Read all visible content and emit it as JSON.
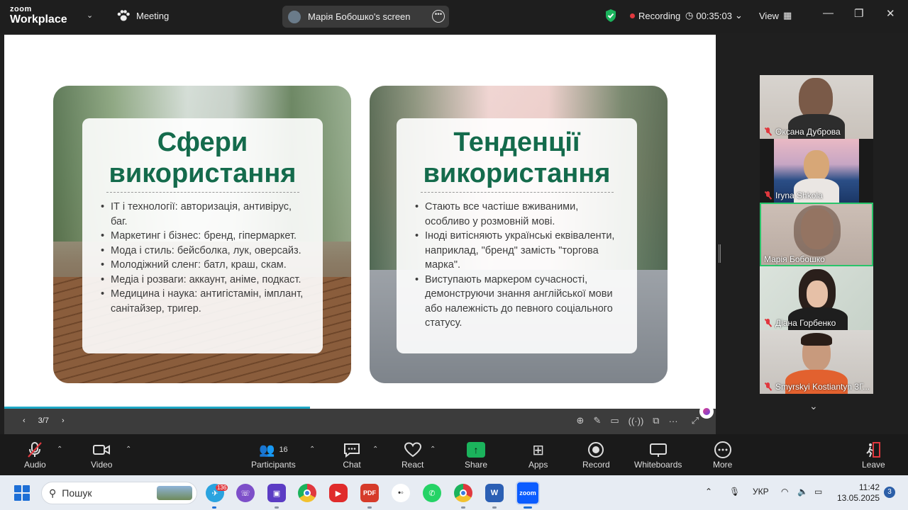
{
  "app": {
    "logo_line1": "zoom",
    "logo_line2": "Workplace",
    "meeting_label": "Meeting"
  },
  "header": {
    "screen_share_label": "Марія Бобошко's screen",
    "recording_label": "Recording",
    "timer": "00:35:03",
    "view_label": "View"
  },
  "slide": {
    "left": {
      "title_line1": "Сфери",
      "title_line2": "використання",
      "bullets": [
        "ІТ і технології: авторизація, антивірус, баг.",
        "Маркетинг і бізнес: бренд, гіпермаркет.",
        "Мода і стиль: бейсболка, лук, оверсайз.",
        "Молодіжний сленг: батл, краш, скам.",
        "Медіа і розваги: аккаунт, аніме, подкаст.",
        "Медицина і наука: антигістамін, імплант, санітайзер, тригер."
      ]
    },
    "right": {
      "title_line1": "Тенденції",
      "title_line2": "використання",
      "bullets": [
        "Стають все частіше вживаними, особливо у розмовній мові.",
        "Іноді витісняють українські еквіваленти, наприклад, \"бренд\" замість \"торгова марка\".",
        "Виступають маркером сучасності, демонструючи знання англійської мови або належність до певного соціального статусу."
      ]
    },
    "page_indicator": "3/7",
    "progress_fraction": 0.43
  },
  "participants": [
    {
      "name": "Оксана Дуброва",
      "muted": true
    },
    {
      "name": "Iryna Shkola",
      "muted": true
    },
    {
      "name": "Марія Бобошко",
      "muted": false
    },
    {
      "name": "Діана Горбенко",
      "muted": true
    },
    {
      "name": "Smyrskyi Kostiantyn 3Г...",
      "muted": true
    }
  ],
  "controls": {
    "audio": "Audio",
    "video": "Video",
    "participants": "Participants",
    "participants_count": "16",
    "chat": "Chat",
    "react": "React",
    "share": "Share",
    "apps": "Apps",
    "record": "Record",
    "whiteboards": "Whiteboards",
    "more": "More",
    "leave": "Leave"
  },
  "taskbar": {
    "search_placeholder": "Пошук",
    "telegram_badge": "136",
    "pdf_label": "PDF",
    "word_label": "W",
    "zoom_label": "zoom",
    "language": "УКР",
    "time": "11:42",
    "date": "13.05.2025",
    "notification_count": "3"
  },
  "colors": {
    "accent_green": "#146b4c",
    "active_speaker": "#29c46a",
    "share_green": "#1bb35c",
    "record_red": "#e0383e"
  }
}
